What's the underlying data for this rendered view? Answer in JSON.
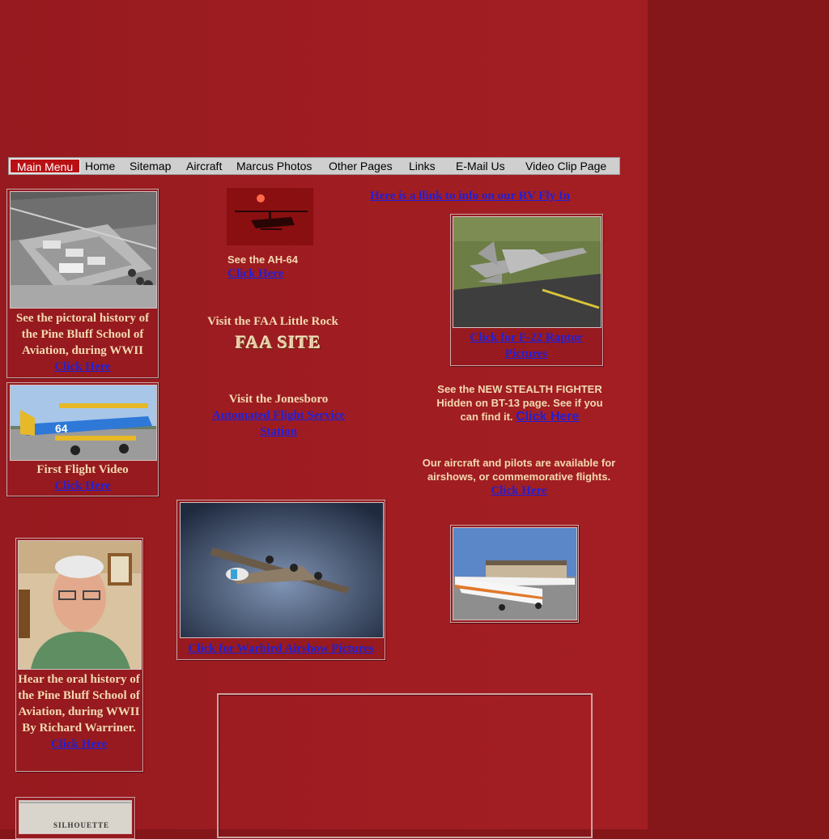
{
  "nav": {
    "items": [
      "Main Menu",
      "Home",
      "Sitemap",
      "Aircraft",
      "Marcus Photos",
      "Other Pages",
      "Links",
      "E-Mail Us",
      "Video Clip Page"
    ]
  },
  "left": {
    "history": {
      "caption": "See the pictoral history of the Pine Bluff School of Aviation, during WWII",
      "link": "Click Here"
    },
    "flight_video": {
      "caption": "First Flight Video",
      "link": "Click Here"
    },
    "oral_history": {
      "caption": "Hear the oral history of the Pine Bluff School of Aviation, during WWII By Richard Warriner.",
      "link": "Click Here"
    },
    "silhouette_text": "SILHOUETTE"
  },
  "middle": {
    "ah64": {
      "caption": "See the AH-64",
      "link": "Click Here"
    },
    "faa": {
      "caption": "Visit the FAA Little Rock",
      "logo_text": "FAA SITE"
    },
    "jonesboro": {
      "caption": "Visit the Jonesboro",
      "link": "Automated Flight Service Station"
    },
    "warbird": {
      "link": "Click for Warbird Airshow Pictures"
    }
  },
  "right": {
    "rv_link": "Here is a llink to info on our RV Fly In",
    "raptor": {
      "link": "Click for F-22 Raptor Pictures"
    },
    "stealth": {
      "text": "See the NEW STEALTH FIGHTER Hidden on BT-13 page. See if you can find it.",
      "link": "Click Here"
    },
    "airshows": {
      "text": "Our aircraft and pilots are available for airshows, or commemorative flights.",
      "link": "Click Here"
    }
  },
  "colors": {
    "background": "#85161a",
    "main_column": "#a01d22",
    "caption_text": "#f3d9b1",
    "link_blue": "#2020d8",
    "nav_active": "#b81014",
    "nav_bar": "#cfcfcf"
  }
}
